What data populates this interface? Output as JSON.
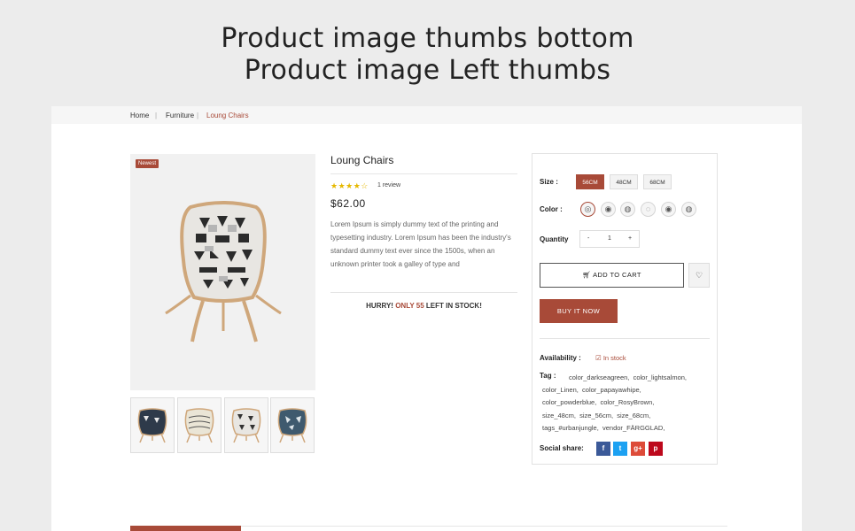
{
  "banner": {
    "line1": "Product image thumbs bottom",
    "line2": "Product image Left thumbs"
  },
  "breadcrumb": [
    "Home",
    "Furniture",
    "Loung Chairs"
  ],
  "product": {
    "badge": "Newest",
    "title": "Loung Chairs",
    "rating": 4,
    "stars": "★★★★☆",
    "reviews": "1 review",
    "price": "$62.00",
    "description": "Lorem Ipsum is simply dummy text of the printing and typesetting industry. Lorem Ipsum has been the industry's standard dummy text ever since the 1500s, when an unknown printer took a galley of type and",
    "hurry_prefix": "HURRY!",
    "hurry_highlight": "ONLY 55",
    "hurry_suffix": "LEFT IN STOCK!"
  },
  "options": {
    "size_label": "Size :",
    "sizes": [
      "56CM",
      "48CM",
      "68CM"
    ],
    "selected_size": "56CM",
    "color_label": "Color :",
    "color_count": 6,
    "quantity_label": "Quantity",
    "qty_minus": "-",
    "quantity": "1",
    "qty_plus": "+",
    "add_to_cart": "ADD TO CART",
    "buy_now": "BUY IT NOW"
  },
  "meta": {
    "availability_label": "Availability :",
    "availability_value": "In stock",
    "tag_label": "Tag :",
    "tags": [
      "color_darkseagreen,",
      "color_lightsalmon,",
      "color_Linen,",
      "color_papayawhipe,",
      "color_powderblue,",
      "color_RosyBrown,",
      "size_48cm,",
      "size_56cm,",
      "size_68cm,",
      "tags_#urbanjungle,",
      "vendor_FÄRGGLAD,"
    ],
    "social_label": "Social share:",
    "social": [
      {
        "name": "facebook",
        "glyph": "f",
        "color": "#3b5998"
      },
      {
        "name": "twitter",
        "glyph": "t",
        "color": "#1da1f2"
      },
      {
        "name": "google-plus",
        "glyph": "g+",
        "color": "#dd4b39"
      },
      {
        "name": "pinterest",
        "glyph": "p",
        "color": "#bd081c"
      }
    ]
  },
  "colors": {
    "accent": "#a84a38",
    "star": "#e6b800"
  }
}
